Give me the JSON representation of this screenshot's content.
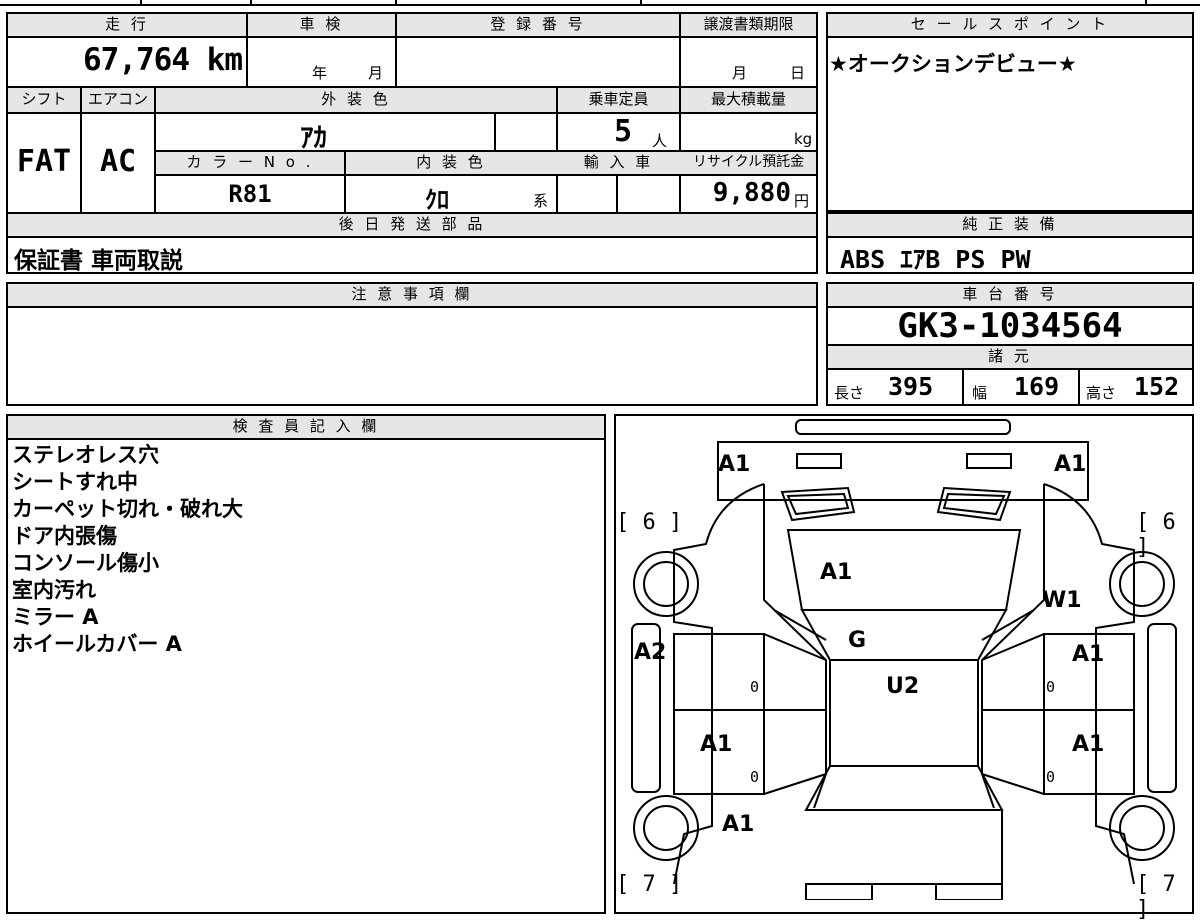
{
  "info": {
    "h_mileage": "走 行",
    "mileage": "67,764 km",
    "h_inspection": "車 検",
    "insp_year": "年",
    "insp_month": "月",
    "h_registration": "登 録 番 号",
    "h_transfer": "譲渡書類期限",
    "trans_month": "月",
    "trans_day": "日",
    "h_shift": "シフト",
    "shift": "FAT",
    "h_ac": "エアコン",
    "ac": "AC",
    "h_ext": "外 装 色",
    "ext": "ｱｶ",
    "h_capacity": "乗車定員",
    "capacity": "5",
    "capacity_unit": "人",
    "h_load": "最大積載量",
    "load_unit": "kg",
    "h_color": "カ ラ ー N o .",
    "color_no": "R81",
    "h_int": "内 装 色",
    "int": "ｸﾛ",
    "int_suffix": "系",
    "h_import": "輸 入 車",
    "h_recycle": "リサイクル預託金",
    "recycle": "9,880",
    "recycle_unit": "円",
    "h_later": "後 日 発 送 部 品",
    "later": "保証書 車両取説"
  },
  "sales": {
    "h": "セ ー ル ス ポ イ ン ト",
    "text": "★オークションデビュー★"
  },
  "equipment": {
    "h": "純 正 装 備",
    "text": "ABS ｴｱB PS PW"
  },
  "caution": {
    "h": "注 意 事 項 欄"
  },
  "chassis": {
    "h": "車 台 番 号",
    "number": "GK3-1034564",
    "h_spec": "諸 元",
    "len_label": "長さ",
    "len": "395",
    "wid_label": "幅",
    "wid": "169",
    "hei_label": "高さ",
    "hei": "152"
  },
  "inspector": {
    "h": "検 査 員 記 入 欄",
    "notes": [
      "ステレオレス穴",
      "シートすれ中",
      "カーペット切れ・破れ大",
      "ドア内張傷",
      "コンソール傷小",
      "室内汚れ",
      "ミラー A",
      "ホイールカバー A"
    ]
  },
  "diagram": {
    "labels": {
      "fl_corner": "A1",
      "fr_corner": "A1",
      "hood": "A1",
      "windshield": "W1",
      "grille": "G",
      "roof": "U2",
      "left_front_door": "A2",
      "right_front_door": "A1",
      "left_rear_door": "A1",
      "right_rear_door": "A1",
      "rear_left": "A1"
    },
    "tire_fl": "[ 6 ]",
    "tire_fr": "[ 6 ]",
    "tire_rl": "[ 7 ]",
    "tire_rr": "[ 7 ]",
    "zeros": [
      "0",
      "0",
      "0",
      "0"
    ]
  }
}
